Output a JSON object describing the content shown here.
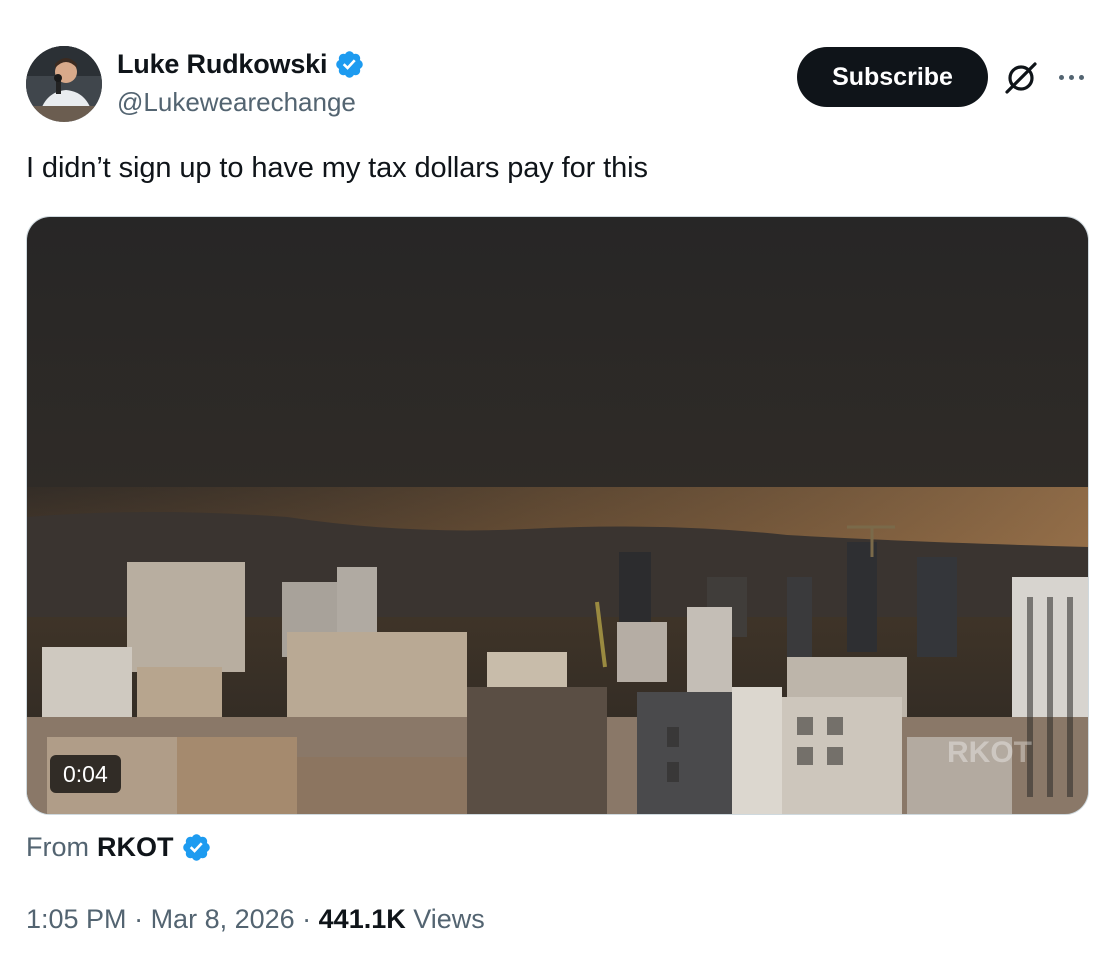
{
  "author": {
    "display_name": "Luke Rudkowski",
    "handle": "@Lukewearechange",
    "verified": true
  },
  "actions": {
    "subscribe_label": "Subscribe",
    "grok_icon": "grok-slash-icon",
    "more_icon": "more-dots-icon"
  },
  "tweet": {
    "text": "I didn’t sign up to have my tax dollars pay for this"
  },
  "media": {
    "type": "video",
    "duration": "0:04",
    "watermark": "RKOT"
  },
  "attribution": {
    "prefix": "From",
    "source": "RKOT",
    "verified": true
  },
  "meta": {
    "time": "1:05 PM",
    "separator": " · ",
    "date": "Mar 8, 2026",
    "views_count": "441.1K",
    "views_label": "Views"
  },
  "colors": {
    "verified_blue": "#1d9bf0",
    "text_primary": "#0f1419",
    "text_secondary": "#536471",
    "button_dark": "#0f1419"
  }
}
